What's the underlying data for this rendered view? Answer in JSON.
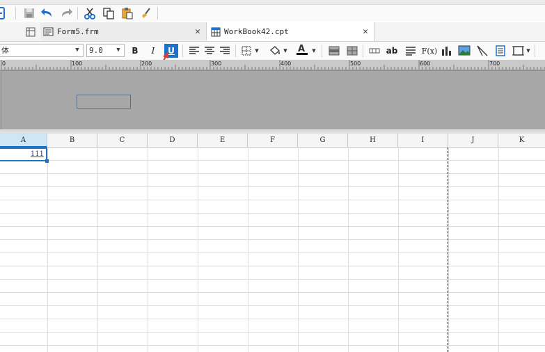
{
  "tabs": [
    {
      "label": "Form5.frm",
      "active": false
    },
    {
      "label": "WorkBook42.cpt",
      "active": true
    }
  ],
  "format_bar": {
    "font_name": "体",
    "font_size": "9.0",
    "bold": "B",
    "italic": "I",
    "underline": "U",
    "text_tool": "ab",
    "formula": "F(x)"
  },
  "ruler": {
    "labels": [
      "0",
      "100",
      "200",
      "300",
      "400",
      "500",
      "600",
      "700"
    ]
  },
  "sheet": {
    "columns": [
      "A",
      "B",
      "C",
      "D",
      "E",
      "F",
      "G",
      "H",
      "I",
      "J",
      "K"
    ],
    "cell_a1": "111"
  },
  "colors": {
    "accent": "#1e73c8",
    "annotation": "#e8382c",
    "canvas": "#a7a7a7"
  }
}
